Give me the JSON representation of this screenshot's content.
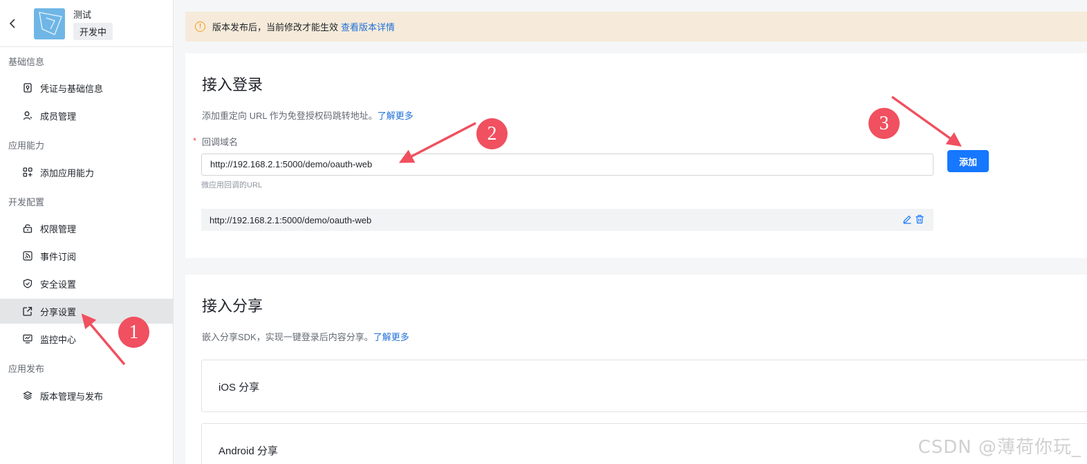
{
  "app": {
    "name": "测试",
    "status": "开发中"
  },
  "sidebar": {
    "groups": [
      {
        "title": "基础信息",
        "items": [
          {
            "label": "凭证与基础信息",
            "icon": "credential-icon"
          },
          {
            "label": "成员管理",
            "icon": "user-icon"
          }
        ]
      },
      {
        "title": "应用能力",
        "items": [
          {
            "label": "添加应用能力",
            "icon": "apps-add-icon"
          }
        ]
      },
      {
        "title": "开发配置",
        "items": [
          {
            "label": "权限管理",
            "icon": "lock-icon"
          },
          {
            "label": "事件订阅",
            "icon": "rss-icon"
          },
          {
            "label": "安全设置",
            "icon": "shield-icon"
          },
          {
            "label": "分享设置",
            "icon": "share-icon",
            "active": true
          },
          {
            "label": "监控中心",
            "icon": "monitor-icon"
          }
        ]
      },
      {
        "title": "应用发布",
        "items": [
          {
            "label": "版本管理与发布",
            "icon": "layers-icon"
          }
        ]
      }
    ]
  },
  "notice": {
    "text": "版本发布后，当前修改才能生效",
    "link": "查看版本详情"
  },
  "login_section": {
    "title": "接入登录",
    "desc": "添加重定向 URL 作为免登授权码跳转地址。",
    "desc_link": "了解更多",
    "field_label": "回调域名",
    "input_value": "http://192.168.2.1:5000/demo/oauth-web",
    "hint": "微应用回调的URL",
    "add_button": "添加",
    "saved_urls": [
      "http://192.168.2.1:5000/demo/oauth-web"
    ]
  },
  "share_section": {
    "title": "接入分享",
    "desc": "嵌入分享SDK，实现一键登录后内容分享。",
    "desc_link": "了解更多",
    "platforms": [
      "iOS 分享",
      "Android 分享"
    ]
  },
  "annotations": [
    "1",
    "2",
    "3"
  ],
  "watermark": "CSDN @薄荷你玩_",
  "colors": {
    "primary": "#1677ff",
    "link": "#1e6fd9",
    "notice_bg": "#f6ebda",
    "warning": "#f29c1f",
    "annotation": "#f0505f",
    "required": "#f54a45"
  }
}
